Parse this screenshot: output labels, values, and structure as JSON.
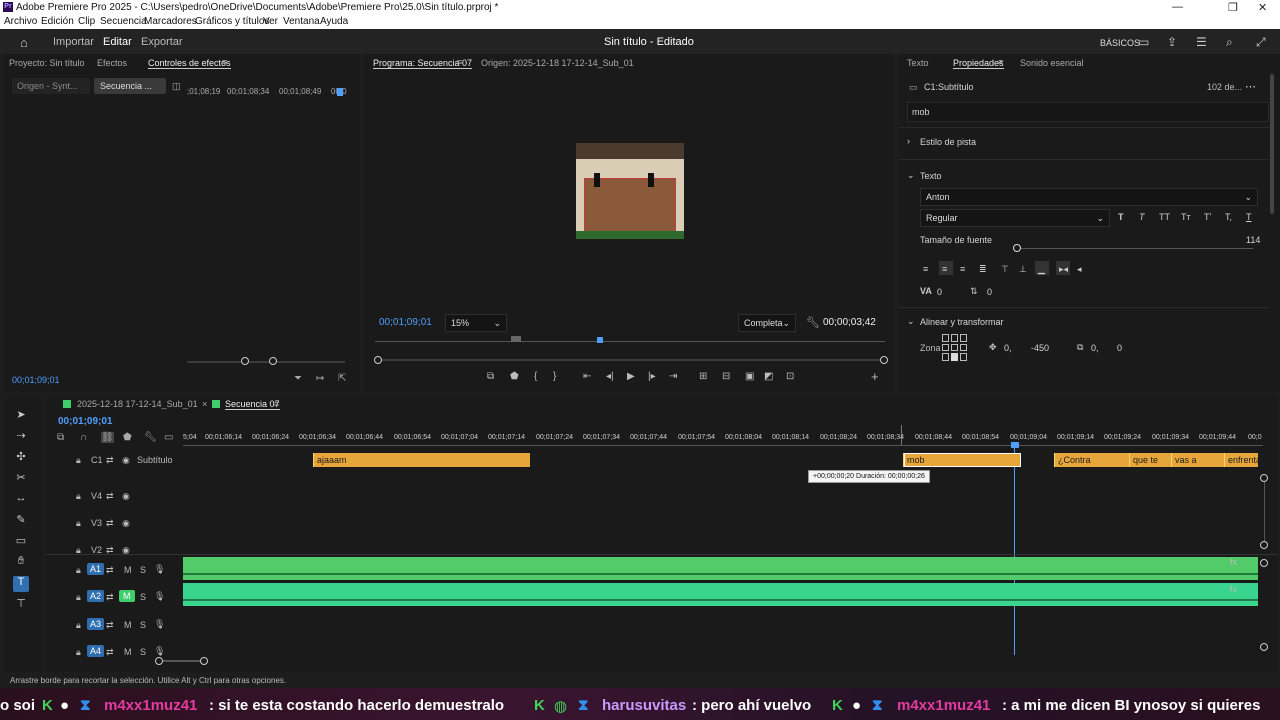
{
  "window": {
    "title": "Adobe Premiere Pro 2025 - C:\\Users\\pedro\\OneDrive\\Documents\\Adobe\\Premiere Pro\\25.0\\Sin título.prproj *",
    "logo": "Pr"
  },
  "menu": [
    "Archivo",
    "Edición",
    "Clip",
    "Secuencia",
    "Marcadores",
    "Gráficos y títulos",
    "Ver",
    "Ventana",
    "Ayuda"
  ],
  "header": {
    "tabs": [
      "Importar",
      "Editar",
      "Exportar"
    ],
    "project_title": "Sin título - Editado",
    "workspace": "BÁSICOS"
  },
  "left_panel": {
    "tabs": [
      "Proyecto: Sin título",
      "Efectos",
      "Controles de efectos"
    ],
    "subtabs": [
      "Origen - Synt...",
      "Secuencia ..."
    ],
    "ruler_times": [
      ";01;08;19",
      "00;01;08;34",
      "00;01;08;49",
      "00;0"
    ],
    "timecode": "00;01;09;01"
  },
  "program": {
    "tabs": [
      "Programa: Secuencia 07",
      "Origen: 2025-12-18 17-12-14_Sub_01"
    ],
    "timecode": "00;01;09;01",
    "zoom": "15%",
    "quality": "Completa",
    "duration": "00;00;03;42"
  },
  "properties": {
    "tabs": [
      "Texto",
      "Propiedades",
      "Sonido esencial"
    ],
    "item_name": "C1:Subtítulo",
    "item_count": "102 de...",
    "text_value": "mob",
    "section_track_style": "Estilo de pista",
    "section_text": "Texto",
    "font": "Anton",
    "font_style": "Regular",
    "font_size_label": "Tamaño de fuente",
    "font_size": "114",
    "tracking": "0",
    "leading": "0",
    "section_align": "Alinear y transformar",
    "zone_label": "Zona",
    "pos_x": "0,",
    "pos_y": "-450",
    "anchor_x": "0,",
    "anchor_y": "0"
  },
  "timeline": {
    "tabs": [
      "2025-12-18 17-12-14_Sub_01",
      "Secuencia 07"
    ],
    "timecode": "00;01;09;01",
    "ruler": [
      "5;04",
      "00;01;06;14",
      "00;01;06;24",
      "00;01;06;34",
      "00;01;06;44",
      "00;01;06;54",
      "00;01;07;04",
      "00;01;07;14",
      "00;01;07;24",
      "00;01;07;34",
      "00;01;07;44",
      "00;01;07;54",
      "00;01;08;04",
      "00;01;08;14",
      "00;01;08;24",
      "00;01;08;34",
      "00;01;08;44",
      "00;01;08;54",
      "00;01;09;04",
      "00;01;09;14",
      "00;01;09;24",
      "00;01;09;34",
      "00;01;09;44",
      "00;0"
    ],
    "subtitle_track": "Subtítulo",
    "caption_track_id": "C1",
    "tracks": [
      "V4",
      "V3",
      "V2",
      "A1",
      "A2",
      "A3",
      "A4"
    ],
    "clips": [
      "ajaaam",
      "mob",
      "¿Contra",
      "que te",
      "vas a",
      "enfrenta"
    ],
    "tooltip": "+00;00;00;20 Duración: 00;00;00;26"
  },
  "status_bar": "Arrastre borde para recortar la selección. Utilice Alt y Ctrl para otras opciones.",
  "chat": [
    {
      "name": "",
      "msg": "o soi"
    },
    {
      "name": "m4xx1muz41",
      "msg": ": si te esta costando hacerlo  demuestralo"
    },
    {
      "name": "harusuvitas",
      "msg": ": pero ahí vuelvo"
    },
    {
      "name": "m4xx1muz41",
      "msg": ": a mi me dicen BI ynosoy si quieres"
    }
  ],
  "colors": {
    "accent": "#4f9fff",
    "caption": "#e7a63a",
    "audio": "#3fcd6e",
    "chat_name": "#e33ba0"
  }
}
